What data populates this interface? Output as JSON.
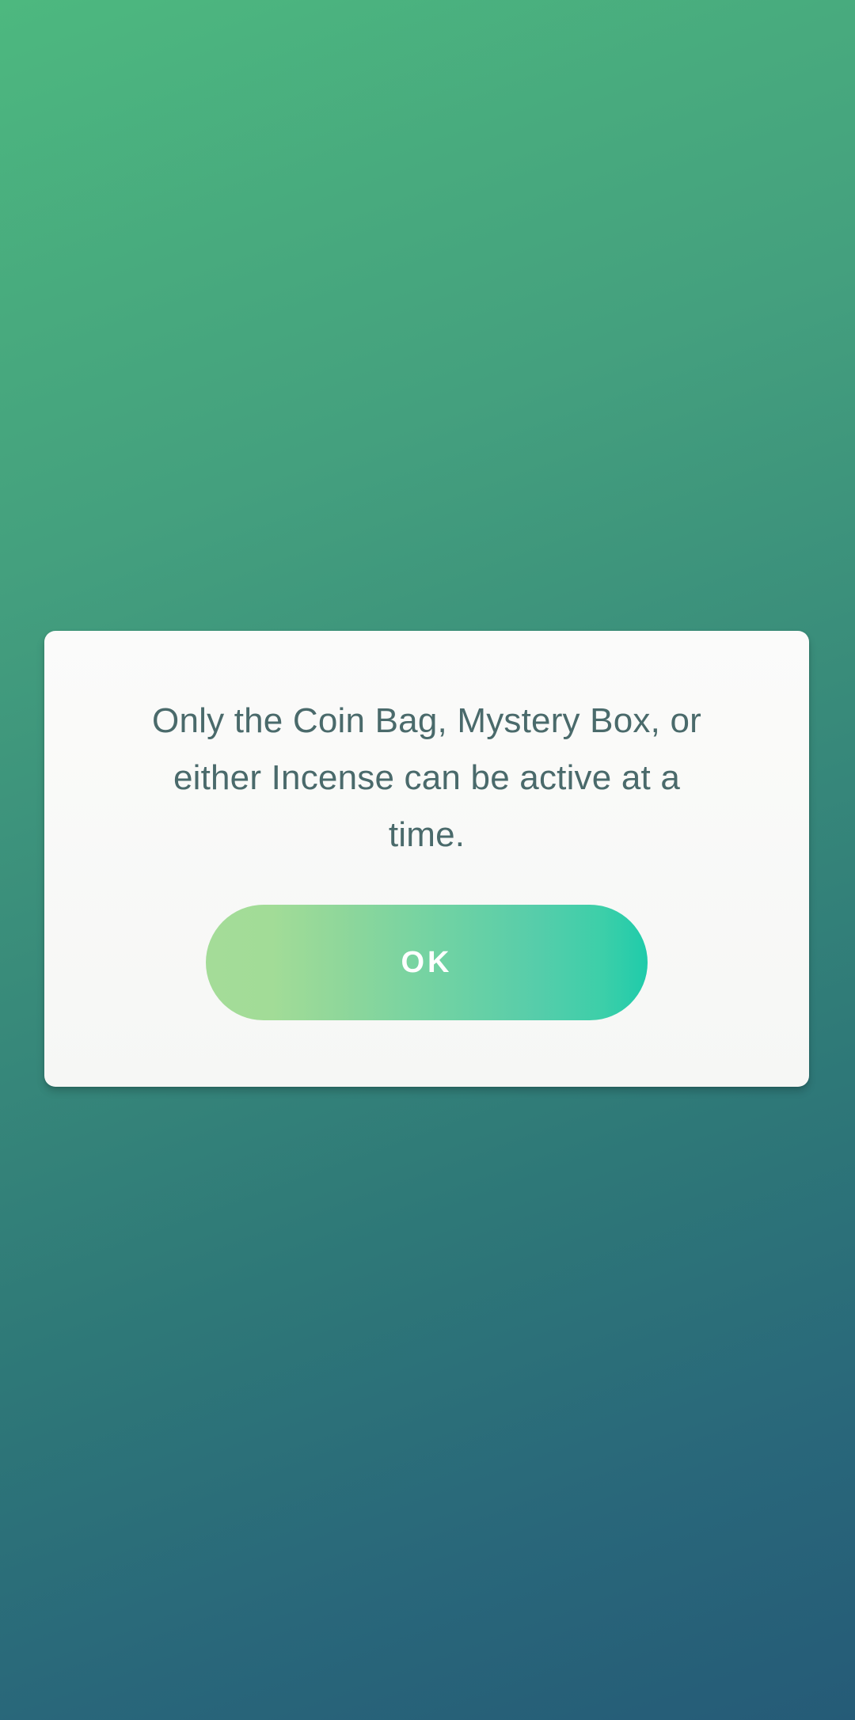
{
  "dialog": {
    "message": "Only the Coin Bag, Mystery Box, or either Incense can be active at a time.",
    "ok_label": "OK"
  },
  "colors": {
    "background_top": "#4db87f",
    "background_bottom": "#255b77",
    "dialog_bg": "#f7f8f6",
    "message_text": "#4a6a6b",
    "button_start": "#a4dc98",
    "button_end": "#1fcbaa",
    "button_text": "#ffffff"
  }
}
